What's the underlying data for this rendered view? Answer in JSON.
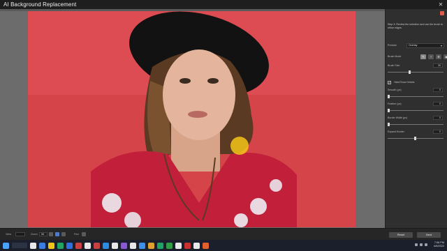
{
  "window": {
    "title": "AI Background Replacement",
    "close_glyph": "✕"
  },
  "panel": {
    "step_text": "Step 3: Review the selection and use the brush to refine edges.",
    "preview_label": "Preview",
    "preview_value": "Overlay",
    "brush_mode_label": "Brush Mode",
    "brush_icons": [
      "brush-keep-icon",
      "brush-remove-icon",
      "brush-restore-icon",
      "brush-erase-icon"
    ],
    "brush_size_label": "Brush Size",
    "brush_size_value": "30",
    "hide_show_label": "Hide/Show Details",
    "smooth_label": "Smooth (px)",
    "smooth_value": "0",
    "feather_label": "Feather (px)",
    "feather_value": "0",
    "border_width_label": "Border Width (px)",
    "border_width_value": "0",
    "expand_label": "Expand Border",
    "expand_value": "0"
  },
  "bottom": {
    "view_label": "View",
    "zoom_label": "Zoom",
    "zoom_value": "56",
    "pan_label": "Pan",
    "reset_label": "Reset",
    "next_label": "Next"
  },
  "taskbar": {
    "time": "7:56 PM",
    "date": "6/6/2022",
    "app_colors": [
      "#e8e8e8",
      "#3b7de0",
      "#f0c419",
      "#1fa463",
      "#2f6fe0",
      "#c94040",
      "#e8e8e8",
      "#c94040",
      "#2a8de0",
      "#e8e8e8",
      "#8a58d6",
      "#e8e8e8",
      "#3d8fe8",
      "#e0a030",
      "#1fa463",
      "#2f9e44",
      "#e8e8e8",
      "#c93030",
      "#e8e8e8",
      "#e06030"
    ]
  },
  "colors": {
    "background": "#d94a50",
    "accent_cursor": "#f5c518"
  }
}
